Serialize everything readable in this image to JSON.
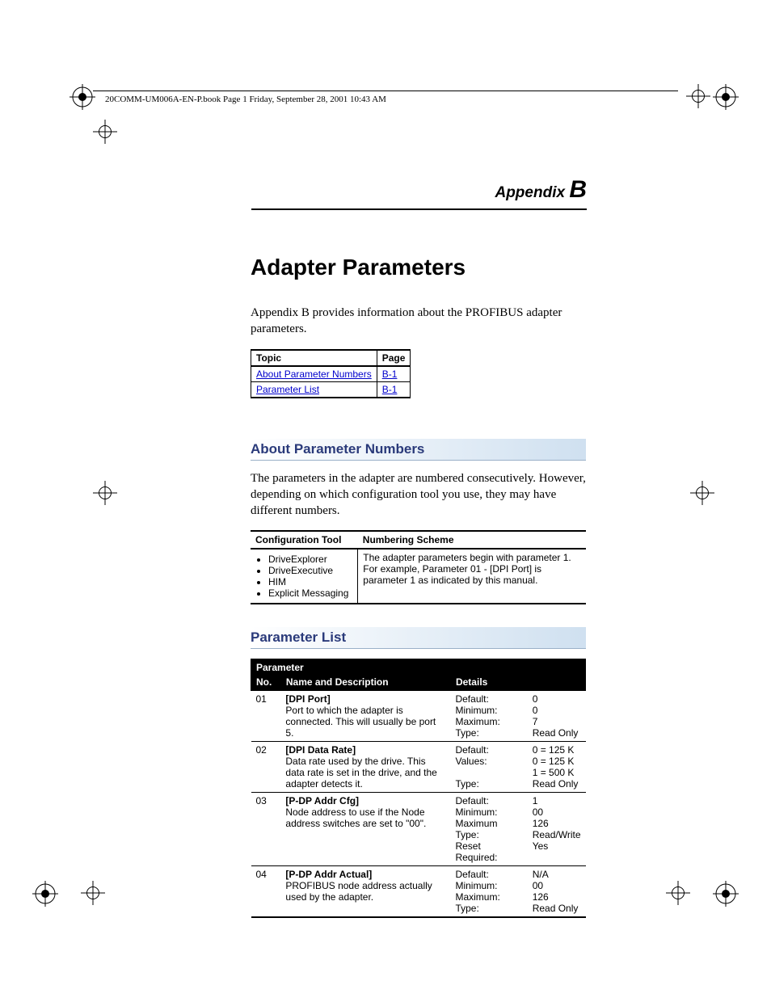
{
  "header": {
    "running_text": "20COMM-UM006A-EN-P.book  Page 1  Friday, September 28, 2001  10:43 AM"
  },
  "appendix": {
    "label": "Appendix",
    "letter": "B"
  },
  "title": "Adapter Parameters",
  "intro": "Appendix B provides information about the PROFIBUS adapter parameters.",
  "topic_table": {
    "headers": {
      "topic": "Topic",
      "page": "Page"
    },
    "rows": [
      {
        "topic": "About Parameter Numbers",
        "page": "B-1"
      },
      {
        "topic": "Parameter List",
        "page": "B-1"
      }
    ]
  },
  "section1": {
    "heading": "About Parameter Numbers",
    "body": "The parameters in the adapter are numbered consecutively. However, depending on which configuration tool you use, they may have different numbers."
  },
  "config_table": {
    "headers": {
      "tool": "Configuration Tool",
      "scheme": "Numbering Scheme"
    },
    "tools": [
      "DriveExplorer",
      "DriveExecutive",
      "HIM",
      "Explicit Messaging"
    ],
    "scheme": "The adapter parameters begin with parameter 1. For example, Parameter 01 - [DPI Port] is parameter 1 as indicated by this manual."
  },
  "section2": {
    "heading": "Parameter List"
  },
  "param_table": {
    "group_header": "Parameter",
    "headers": {
      "no": "No.",
      "name": "Name and Description",
      "details": "Details"
    },
    "rows": [
      {
        "no": "01",
        "name": "[DPI Port]",
        "desc": "Port to which the adapter is connected. This will usually be port 5.",
        "detail_labels": [
          "Default:",
          "Minimum:",
          "Maximum:",
          "Type:"
        ],
        "detail_values": [
          "0",
          "0",
          "7",
          "Read Only"
        ]
      },
      {
        "no": "02",
        "name": "[DPI Data Rate]",
        "desc": "Data rate used by the drive. This data rate is set in the drive, and the adapter detects it.",
        "detail_labels": [
          "Default:",
          "Values:",
          "",
          "Type:"
        ],
        "detail_values": [
          "0 = 125 K",
          "0 = 125 K",
          "1 = 500 K",
          "Read Only"
        ]
      },
      {
        "no": "03",
        "name": "[P-DP Addr Cfg]",
        "desc": "Node address to use if the Node address switches are set to \"00\".",
        "detail_labels": [
          "Default:",
          "Minimum:",
          "Maximum",
          "Type:",
          "Reset Required:"
        ],
        "detail_values": [
          "1",
          "00",
          "126",
          "Read/Write",
          "Yes"
        ]
      },
      {
        "no": "04",
        "name": "[P-DP Addr Actual]",
        "desc": "PROFIBUS node address actually used by the adapter.",
        "detail_labels": [
          "Default:",
          "Minimum:",
          "Maximum:",
          "Type:"
        ],
        "detail_values": [
          "N/A",
          "00",
          "126",
          "Read Only"
        ]
      }
    ]
  }
}
